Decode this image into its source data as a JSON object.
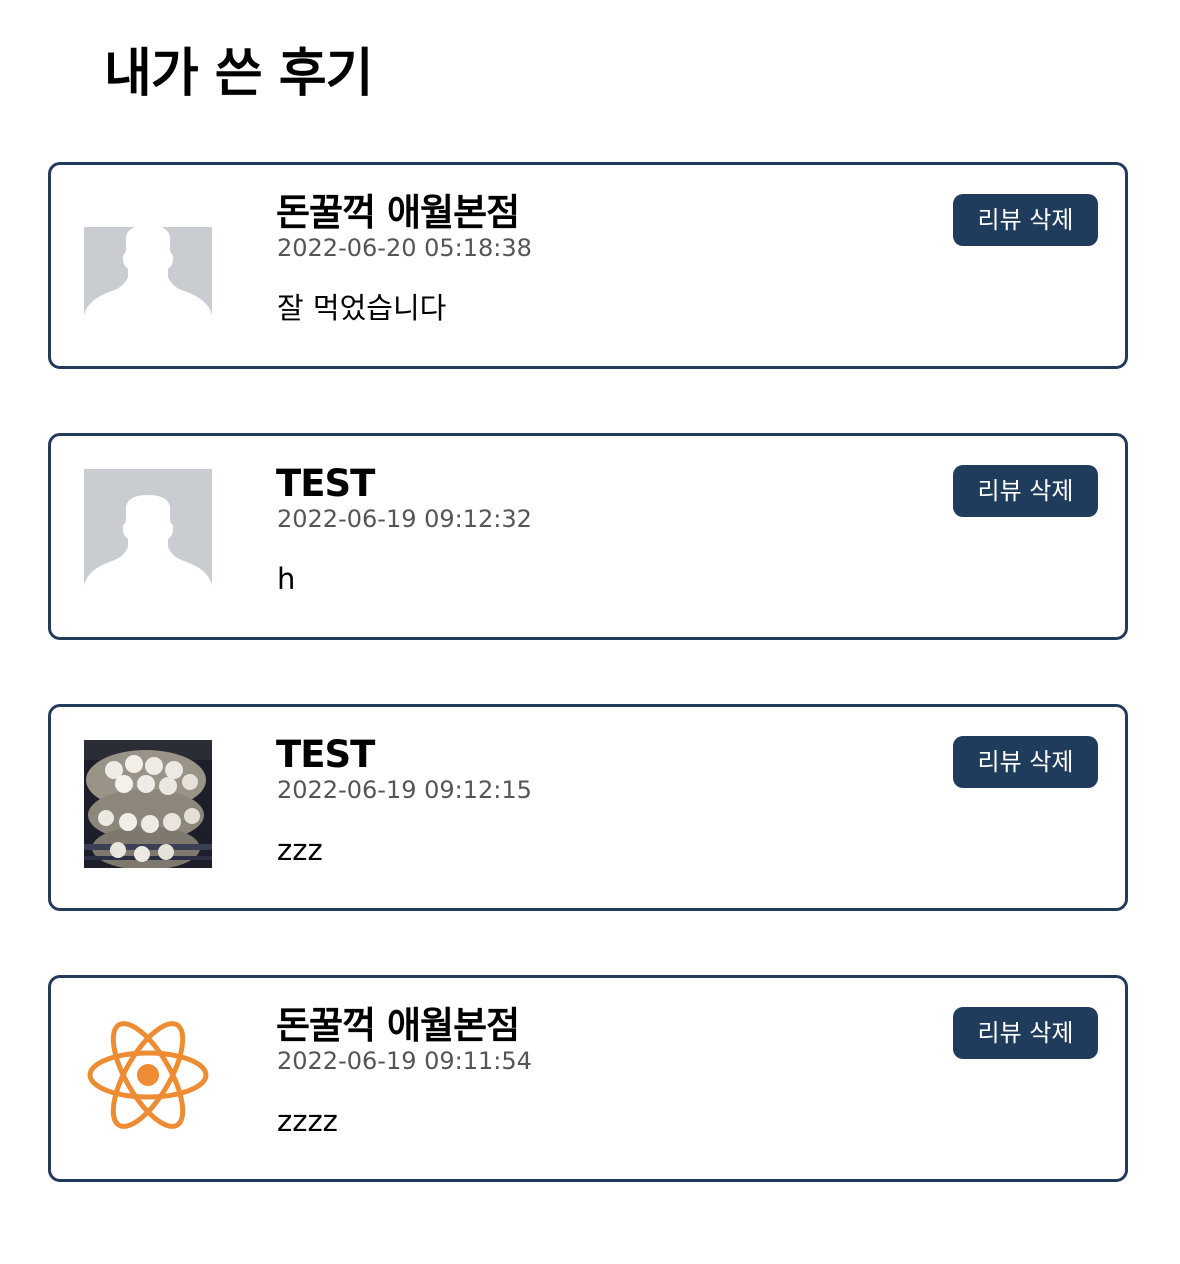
{
  "page": {
    "title": "내가 쓴 후기"
  },
  "reviews": [
    {
      "store_name": "돈꿀꺽 애월본점",
      "date": "2022-06-20 05:18:38",
      "content": "잘 먹었습니다",
      "image": "default-avatar-icon",
      "delete_label": "리뷰 삭제"
    },
    {
      "store_name": "TEST",
      "date": "2022-06-19 09:12:32",
      "content": "h",
      "image": "default-avatar-icon",
      "delete_label": "리뷰 삭제"
    },
    {
      "store_name": "TEST",
      "date": "2022-06-19 09:12:15",
      "content": "zzz",
      "image": "dumpling-photo",
      "delete_label": "리뷰 삭제"
    },
    {
      "store_name": "돈꿀꺽 애월본점",
      "date": "2022-06-19 09:11:54",
      "content": "zzzz",
      "image": "react-atom-icon",
      "delete_label": "리뷰 삭제"
    }
  ],
  "colors": {
    "accent": "#203c5c",
    "card_border": "#233b5b",
    "avatar_bg": "#c9ccd1",
    "atom": "#ee8c34"
  }
}
